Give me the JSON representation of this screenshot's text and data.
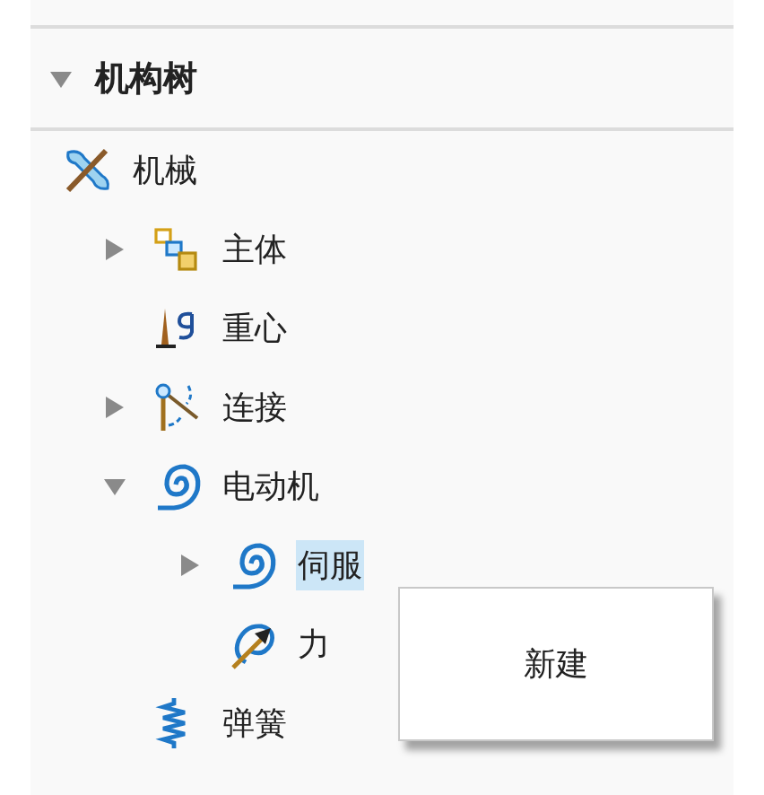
{
  "panel": {
    "title": "机构树",
    "expanded": true
  },
  "tree": [
    {
      "label": "机械",
      "kind": "mechanism",
      "selected": false,
      "children": [
        {
          "label": "主体",
          "kind": "bodies",
          "selected": false,
          "expanded": false
        },
        {
          "label": "重心",
          "kind": "gravity",
          "selected": false
        },
        {
          "label": "连接",
          "kind": "connections",
          "selected": false,
          "expanded": false
        },
        {
          "label": "电动机",
          "kind": "motor",
          "selected": false,
          "expanded": true,
          "children": [
            {
              "label": "伺服",
              "kind": "servo",
              "selected": true,
              "expanded": false
            },
            {
              "label": "力",
              "kind": "force",
              "selected": false
            }
          ]
        },
        {
          "label": "弹簧",
          "kind": "spring",
          "selected": false
        }
      ]
    }
  ],
  "context_menu": {
    "items": [
      "新建"
    ]
  }
}
